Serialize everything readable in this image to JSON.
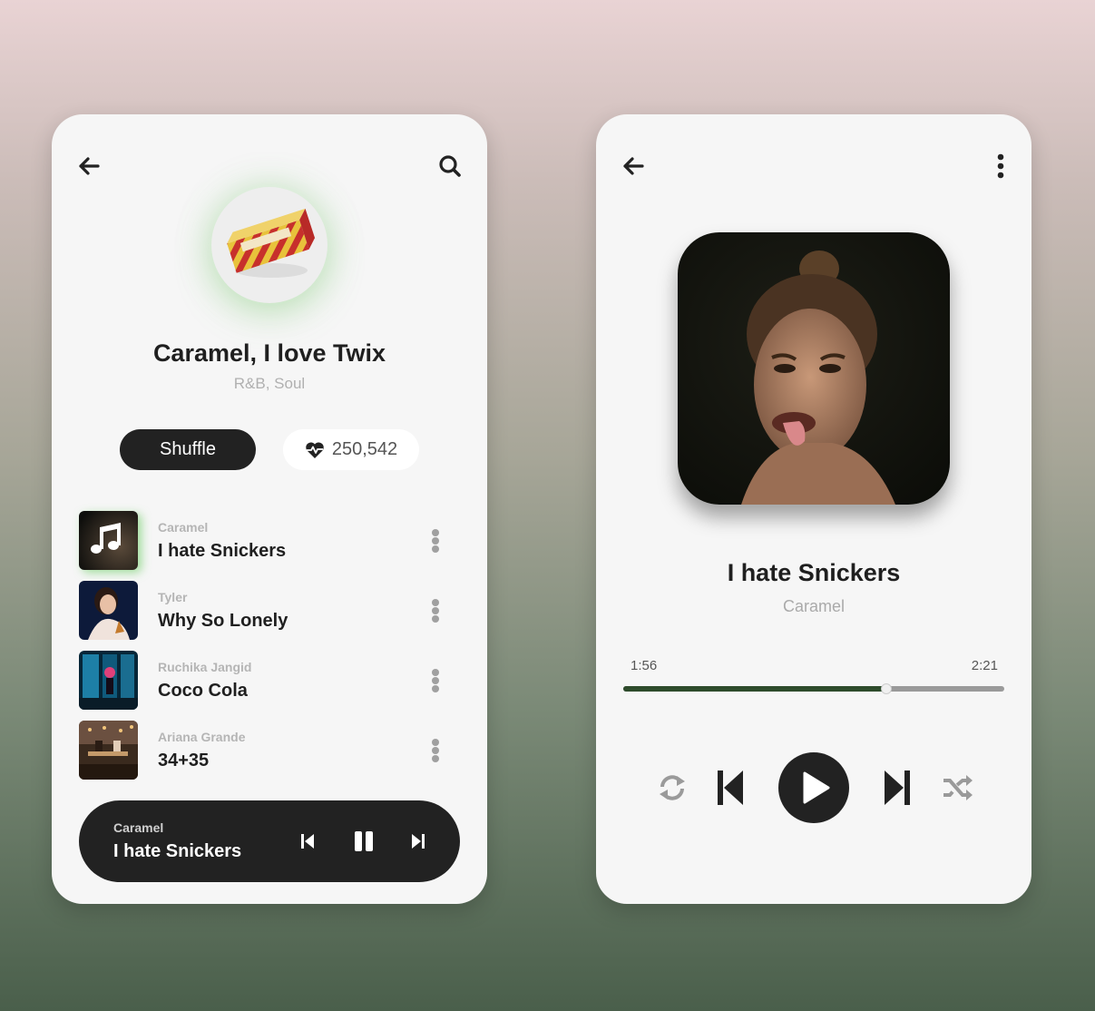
{
  "playlist": {
    "album_title": "Caramel, I love Twix",
    "genre": "R&B, Soul",
    "shuffle_label": "Shuffle",
    "likes": "250,542",
    "tracks": [
      {
        "artist": "Caramel",
        "title": "I hate Snickers",
        "thumb": "music-note-thumb"
      },
      {
        "artist": "Tyler",
        "title": "Why So Lonely",
        "thumb": "portrait-thumb"
      },
      {
        "artist": "Ruchika Jangid",
        "title": "Coco Cola",
        "thumb": "neon-window-thumb"
      },
      {
        "artist": "Ariana Grande",
        "title": "34+35",
        "thumb": "cafe-thumb"
      }
    ],
    "mini_player": {
      "artist": "Caramel",
      "title": "I hate Snickers"
    }
  },
  "now_playing": {
    "title": "I hate Snickers",
    "artist": "Caramel",
    "elapsed": "1:56",
    "duration": "2:21",
    "progress": 0.69
  },
  "colors": {
    "accent": "#2e4b2c",
    "dark": "#222222",
    "card": "#f6f6f6"
  }
}
